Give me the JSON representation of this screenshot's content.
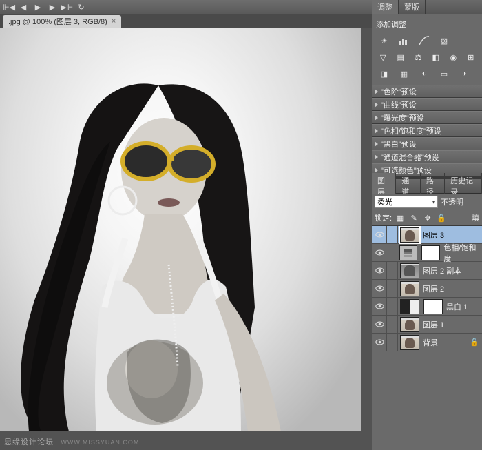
{
  "toolbar": {
    "icons": [
      "first",
      "prev",
      "play",
      "next",
      "last",
      "loop"
    ]
  },
  "document": {
    "tab_label": ".jpg @ 100% (图层 3, RGB/8)"
  },
  "panels": {
    "adjustments": {
      "tabs": [
        "调整",
        "蒙版"
      ],
      "title": "添加调整",
      "icon_rows": [
        [
          "brightness",
          "levels",
          "curves",
          "exposure"
        ],
        [
          "vibrance",
          "huesat",
          "colorbalance",
          "bw",
          "photofilter",
          "channelmixer"
        ],
        [
          "invert",
          "posterize",
          "threshold",
          "gradientmap",
          "selectivecolor"
        ]
      ],
      "presets": [
        "\"色阶\"预设",
        "\"曲线\"预设",
        "\"曝光度\"预设",
        "\"色相/饱和度\"预设",
        "\"黑白\"预设",
        "\"通道混合器\"预设",
        "\"可选颜色\"预设"
      ]
    },
    "layers": {
      "tabs": [
        "图层",
        "通道",
        "路径",
        "历史记录"
      ],
      "blend_mode": "柔光",
      "opacity_label": "不透明",
      "lock_label": "锁定:",
      "fill_label": "填",
      "items": [
        {
          "name": "图层 3",
          "selected": true,
          "thumb": "photo"
        },
        {
          "name": "色相/饱和度",
          "thumb": "adj-hs",
          "has_mask": true
        },
        {
          "name": "图层 2 副本",
          "thumb": "photo-gray"
        },
        {
          "name": "图层 2",
          "thumb": "photo-sm"
        },
        {
          "name": "黑白 1",
          "thumb": "adj-bw",
          "has_mask": true
        },
        {
          "name": "图层 1",
          "thumb": "photo-sm"
        },
        {
          "name": "背景",
          "thumb": "photo-sm",
          "locked": true
        }
      ]
    }
  },
  "watermark": {
    "main": "思缘设计论坛",
    "sub": "WWW.MISSYUAN.COM"
  }
}
